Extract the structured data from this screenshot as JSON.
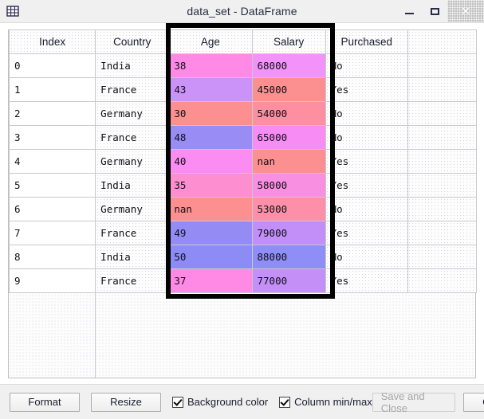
{
  "window": {
    "title": "data_set - DataFrame",
    "icon": "table-grid-icon",
    "minimize_label": "–",
    "maximize_label": "□",
    "close_label": "✕"
  },
  "table": {
    "columns": [
      "Index",
      "Country",
      "Age",
      "Salary",
      "Purchased",
      ""
    ],
    "rows": [
      {
        "index": "0",
        "country": "India",
        "age": "38",
        "salary": "68000",
        "purchased": "No",
        "age_color": "#ff8ae6",
        "salary_color": "#f393f9"
      },
      {
        "index": "1",
        "country": "France",
        "age": "43",
        "salary": "45000",
        "purchased": "Yes",
        "age_color": "#cb92f7",
        "salary_color": "#fc9090"
      },
      {
        "index": "2",
        "country": "Germany",
        "age": "30",
        "salary": "54000",
        "purchased": "No",
        "age_color": "#fc9090",
        "salary_color": "#fd8fa0"
      },
      {
        "index": "3",
        "country": "France",
        "age": "48",
        "salary": "65000",
        "purchased": "No",
        "age_color": "#9a8cf5",
        "salary_color": "#f78cf5"
      },
      {
        "index": "4",
        "country": "Germany",
        "age": "40",
        "salary": "nan",
        "purchased": "Yes",
        "age_color": "#fa8cf2",
        "salary_color": "#fc9090"
      },
      {
        "index": "5",
        "country": "India",
        "age": "35",
        "salary": "58000",
        "purchased": "Yes",
        "age_color": "#fd8ecf",
        "salary_color": "#f98fe0"
      },
      {
        "index": "6",
        "country": "Germany",
        "age": "nan",
        "salary": "53000",
        "purchased": "No",
        "age_color": "#fc9090",
        "salary_color": "#fd8fa8"
      },
      {
        "index": "7",
        "country": "France",
        "age": "49",
        "salary": "79000",
        "purchased": "Yes",
        "age_color": "#958bf5",
        "salary_color": "#c18ff7"
      },
      {
        "index": "8",
        "country": "India",
        "age": "50",
        "salary": "88000",
        "purchased": "No",
        "age_color": "#8d8bf6",
        "salary_color": "#8f8df6"
      },
      {
        "index": "9",
        "country": "France",
        "age": "37",
        "salary": "77000",
        "purchased": "Yes",
        "age_color": "#ff8ae6",
        "salary_color": "#c48ff7"
      }
    ]
  },
  "footer": {
    "format_label": "Format",
    "resize_label": "Resize",
    "background_color_label": "Background color",
    "background_color_checked": true,
    "column_minmax_label": "Column min/max",
    "column_minmax_checked": true,
    "save_and_close_label": "Save and Close",
    "save_and_close_enabled": false,
    "close_label": "Close"
  }
}
